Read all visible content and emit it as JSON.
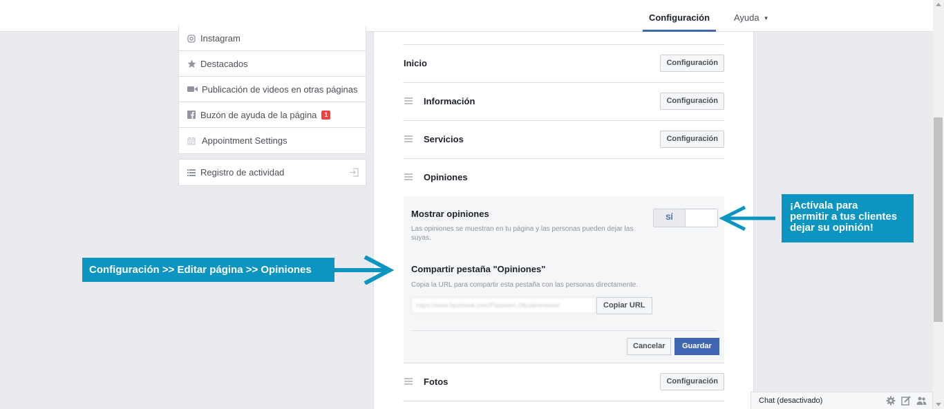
{
  "topbar": {
    "settings_tab": "Configuración",
    "help_tab": "Ayuda",
    "help_caret": "▼"
  },
  "sidebar": {
    "items": [
      {
        "label": "Instagram",
        "icon": "instagram-icon"
      },
      {
        "label": "Destacados",
        "icon": "star-icon"
      },
      {
        "label": "Publicación de videos en otras páginas",
        "icon": "video-camera-icon"
      },
      {
        "label": "Buzón de ayuda de la página",
        "icon": "facebook-icon",
        "badge": "1"
      },
      {
        "label": "Appointment Settings",
        "icon": "calendar-icon"
      }
    ],
    "activity_log": "Registro de actividad"
  },
  "tabs": {
    "rows": [
      {
        "title": "Inicio",
        "button": "Configuración"
      },
      {
        "title": "Información",
        "button": "Configuración"
      },
      {
        "title": "Servicios",
        "button": "Configuración"
      },
      {
        "title": "Opiniones"
      },
      {
        "title": "Fotos",
        "button": "Configuración"
      }
    ]
  },
  "opinions": {
    "show_title": "Mostrar opiniones",
    "show_desc": "Las opiniones se muestran en tu página y las personas pueden dejar las suyas.",
    "toggle_label": "SÍ",
    "toggle_on": true,
    "share_title": "Compartir pestaña \"Opiniones\"",
    "share_desc": "Copia la URL para compartir esta pestaña con las personas directamente.",
    "url_value": "https://www.facebook.com/Pastelero.Oficial/reviews/",
    "copy_button": "Copiar URL",
    "cancel_button": "Cancelar",
    "save_button": "Guardar"
  },
  "callouts": {
    "path": "Configuración >>  Editar página >> Opiniones",
    "activate": [
      "¡Actívala para",
      "permitir a tus clientes",
      "dejar su opinión!"
    ]
  },
  "chat": {
    "label": "Chat (desactivado)"
  },
  "colors": {
    "accent": "#4267b2",
    "callout": "#0c95c1",
    "badge": "#fa3e3e"
  }
}
